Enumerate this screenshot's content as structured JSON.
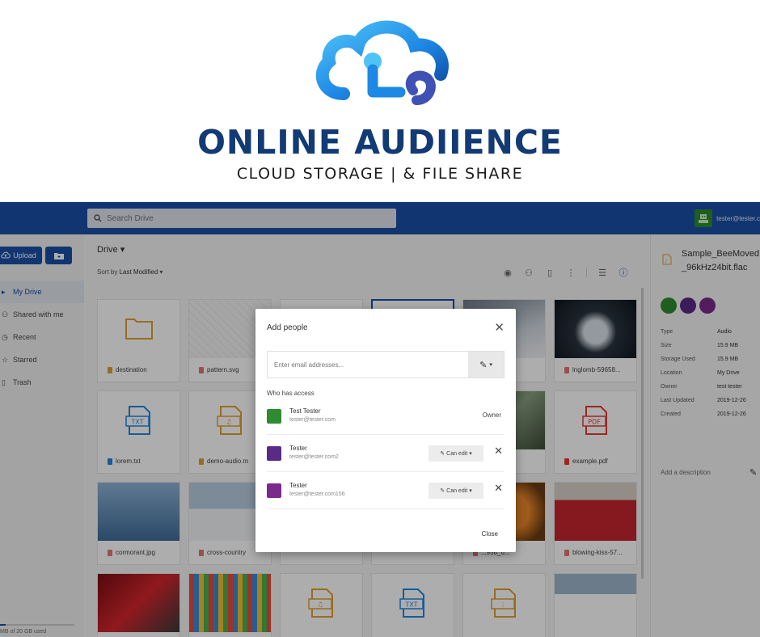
{
  "brand": {
    "name": "ONLINE AUDIIENCE",
    "tagline": "CLOUD STORAGE | & FILE SHARE",
    "colors": {
      "dark_blue": "#123a74",
      "light_blue": "#3fa9f5"
    }
  },
  "topbar": {
    "search_placeholder": "Search Drive",
    "user_email": "tester@tester.c",
    "color": "#1a4ea6"
  },
  "sidebar": {
    "upload_label": "Upload",
    "new_folder_icon": "new-folder-icon",
    "items": [
      {
        "label": "My Drive",
        "icon": "drive-icon",
        "active": true
      },
      {
        "label": "Shared with me",
        "icon": "people-icon",
        "active": false
      },
      {
        "label": "Recent",
        "icon": "clock-icon",
        "active": false
      },
      {
        "label": "Starred",
        "icon": "star-icon",
        "active": false
      },
      {
        "label": "Trash",
        "icon": "trash-icon",
        "active": false
      }
    ],
    "storage_text": "MB of 20 GB used"
  },
  "main": {
    "breadcrumb": "Drive",
    "sort_prefix": "Sort by",
    "sort_value": "Last Modified",
    "toolbar_icons": [
      "eye-icon",
      "add-person-icon",
      "trash-icon",
      "more-icon",
      "grid-view-icon",
      "info-icon"
    ],
    "files": [
      {
        "name": "destination",
        "kind": "folder"
      },
      {
        "name": "pattern.svg",
        "kind": "image-pattern"
      },
      {
        "name": "",
        "kind": "hidden"
      },
      {
        "name": "",
        "kind": "hidden-selected"
      },
      {
        "name": "_640...",
        "kind": "photo-snow"
      },
      {
        "name": "lnglomb-59658...",
        "kind": "photo-ice"
      },
      {
        "name": "lorem.txt",
        "kind": "txt"
      },
      {
        "name": "demo-audio.m",
        "kind": "audio"
      },
      {
        "name": "",
        "kind": "hidden"
      },
      {
        "name": "",
        "kind": "hidden"
      },
      {
        "name": "...981...",
        "kind": "photo-money"
      },
      {
        "name": "example.pdf",
        "kind": "pdf"
      },
      {
        "name": "cormorant.jpg",
        "kind": "photo-bird"
      },
      {
        "name": "cross-country",
        "kind": "photo-ski"
      },
      {
        "name": "",
        "kind": "hidden"
      },
      {
        "name": "",
        "kind": "hidden"
      },
      {
        "name": "...958_6...",
        "kind": "photo-orange"
      },
      {
        "name": "blowing-kiss-57...",
        "kind": "photo-girl"
      },
      {
        "name": "",
        "kind": "photo-car"
      },
      {
        "name": "",
        "kind": "photo-pens"
      },
      {
        "name": "",
        "kind": "audio"
      },
      {
        "name": "",
        "kind": "txt"
      },
      {
        "name": "",
        "kind": "zip"
      },
      {
        "name": "",
        "kind": "photo-skier"
      }
    ]
  },
  "details": {
    "title": "Sample_BeeMoved_96kHz24bit.flac",
    "props": [
      {
        "k": "Type",
        "v": "Audio"
      },
      {
        "k": "Size",
        "v": "15.9 MB"
      },
      {
        "k": "Storage Used",
        "v": "15.9 MB"
      },
      {
        "k": "Location",
        "v": "My Drive"
      },
      {
        "k": "Owner",
        "v": "test tester"
      },
      {
        "k": "Last Updated",
        "v": "2019-12-26"
      },
      {
        "k": "Created",
        "v": "2019-12-26"
      }
    ],
    "add_description": "Add a description"
  },
  "dialog": {
    "title": "Add people",
    "email_placeholder": "Enter email addresses...",
    "who_has_access": "Who has access",
    "people": [
      {
        "name": "Test Tester",
        "email": "tester@tester.com",
        "role": "Owner",
        "editable": false,
        "avatar_color": "#2e8b2e"
      },
      {
        "name": "Tester",
        "email": "tester@tester.com2",
        "role": "Can edit",
        "editable": true,
        "avatar_color": "#5b2a86"
      },
      {
        "name": "Tester",
        "email": "tester@tester.com156",
        "role": "Can edit",
        "editable": true,
        "avatar_color": "#7a2a8a"
      }
    ],
    "close_label": "Close"
  }
}
